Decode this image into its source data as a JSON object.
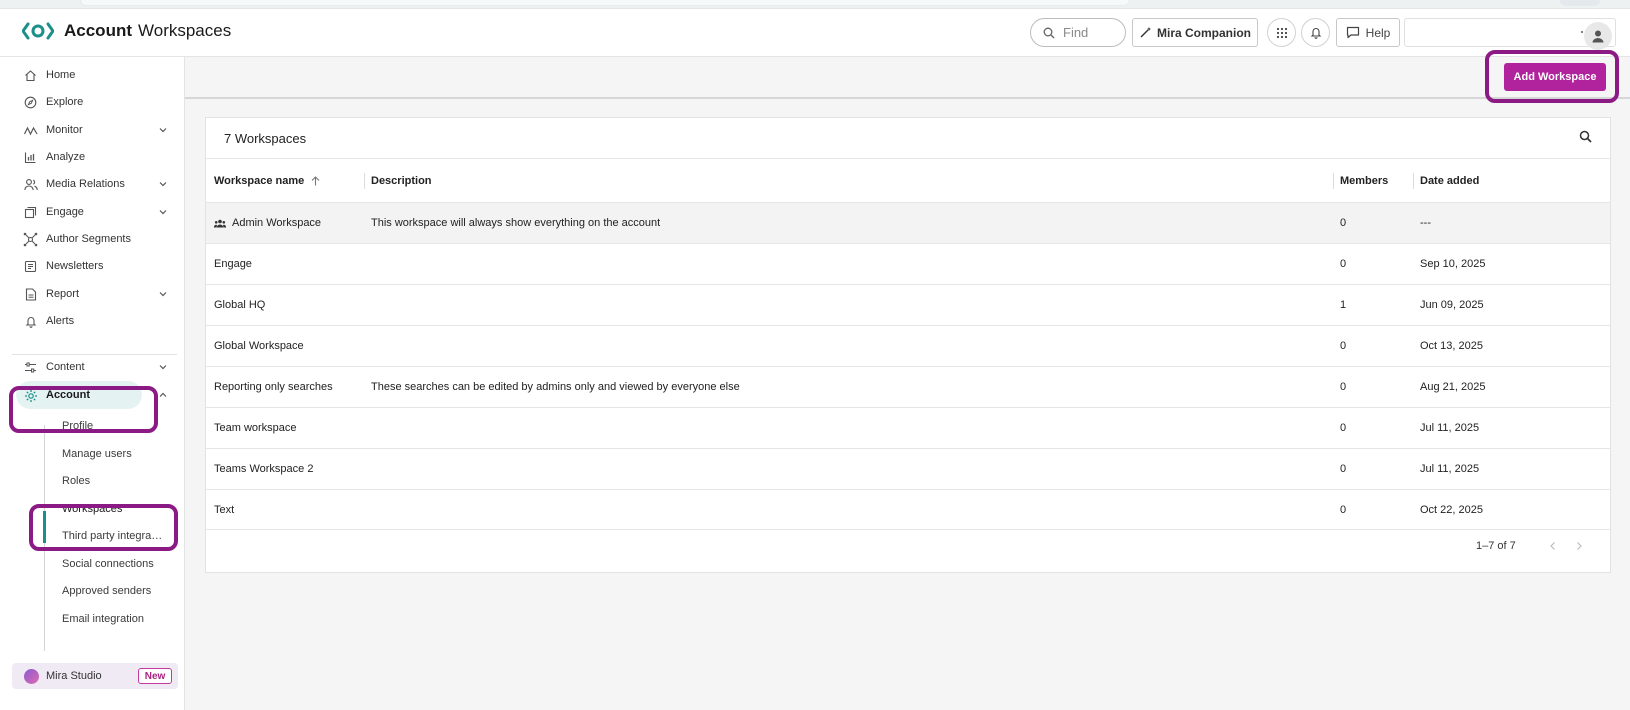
{
  "header": {
    "brand_bold": "Account",
    "brand_light": "Workspaces",
    "find_placeholder": "Find",
    "mira_label": "Mira Companion",
    "help_label": "Help"
  },
  "sidebar": {
    "items": [
      {
        "label": "Home",
        "icon": "home-icon"
      },
      {
        "label": "Explore",
        "icon": "compass-icon"
      },
      {
        "label": "Monitor",
        "icon": "monitor-icon",
        "chevron": "down"
      },
      {
        "label": "Analyze",
        "icon": "chart-icon"
      },
      {
        "label": "Media Relations",
        "icon": "people-icon",
        "chevron": "down"
      },
      {
        "label": "Engage",
        "icon": "engage-icon",
        "chevron": "down"
      },
      {
        "label": "Author Segments",
        "icon": "segments-icon"
      },
      {
        "label": "Newsletters",
        "icon": "newsletter-icon"
      },
      {
        "label": "Report",
        "icon": "report-icon",
        "chevron": "down"
      },
      {
        "label": "Alerts",
        "icon": "bell-icon"
      },
      {
        "label": "Content",
        "icon": "sliders-icon",
        "chevron": "down"
      },
      {
        "label": "Account",
        "icon": "gear-icon",
        "chevron": "up"
      }
    ],
    "subitems": [
      "Profile",
      "Manage users",
      "Roles",
      "Workspaces",
      "Third party integra…",
      "Social connections",
      "Approved senders",
      "Email integration"
    ],
    "studio_label": "Mira Studio",
    "studio_badge": "New"
  },
  "toolbar": {
    "add_label": "Add Workspace"
  },
  "table": {
    "title": "7 Workspaces",
    "columns": [
      "Workspace name",
      "Description",
      "Members",
      "Date added"
    ],
    "rows": [
      {
        "name": "Admin Workspace",
        "description": "This workspace will always show everything on the account",
        "members": "0",
        "date": "---"
      },
      {
        "name": "Engage",
        "description": "",
        "members": "0",
        "date": "Sep 10, 2025"
      },
      {
        "name": "Global HQ",
        "description": "",
        "members": "1",
        "date": "Jun 09, 2025"
      },
      {
        "name": "Global Workspace",
        "description": "",
        "members": "0",
        "date": "Oct 13, 2025"
      },
      {
        "name": "Reporting only searches",
        "description": "These searches can be edited by admins only and viewed by everyone else",
        "members": "0",
        "date": "Aug 21, 2025"
      },
      {
        "name": "Team workspace",
        "description": "",
        "members": "0",
        "date": "Jul 11, 2025"
      },
      {
        "name": "Teams Workspace 2",
        "description": "",
        "members": "0",
        "date": "Jul 11, 2025"
      },
      {
        "name": "Text",
        "description": "",
        "members": "0",
        "date": "Oct 22, 2025"
      }
    ],
    "pagination": "1–7 of 7"
  },
  "colors": {
    "accent": "#b0239d",
    "teal": "#1b8f8a",
    "highlight": "#8b1a85"
  }
}
